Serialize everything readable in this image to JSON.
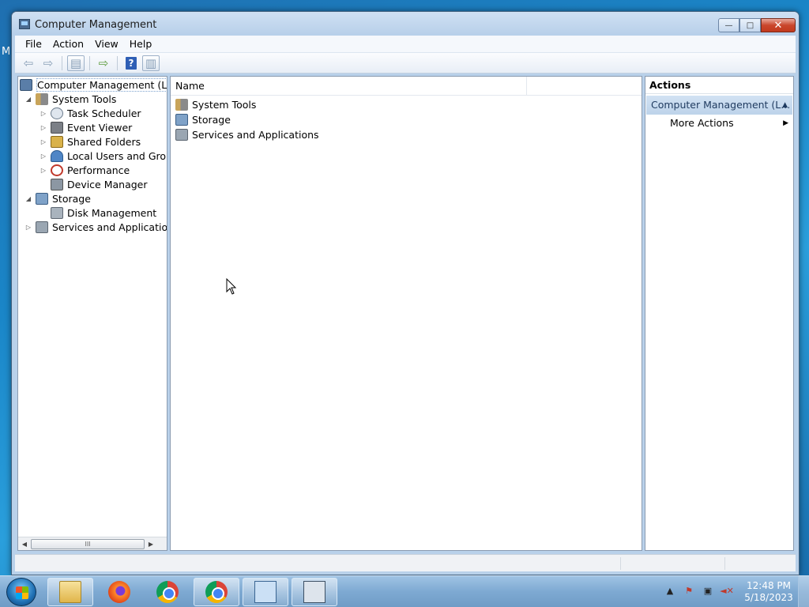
{
  "desktop": {
    "edge_letter": "M"
  },
  "window": {
    "title": "Computer Management",
    "controls": {
      "minimize": "—",
      "maximize": "□",
      "close": "✕"
    }
  },
  "menu": [
    "File",
    "Action",
    "View",
    "Help"
  ],
  "toolbar": {
    "help": "?"
  },
  "tree": {
    "root": "Computer Management (Local",
    "system_tools": "System Tools",
    "task_scheduler": "Task Scheduler",
    "event_viewer": "Event Viewer",
    "shared_folders": "Shared Folders",
    "local_users": "Local Users and Groups",
    "performance": "Performance",
    "device_manager": "Device Manager",
    "storage": "Storage",
    "disk_management": "Disk Management",
    "services_apps": "Services and Applications",
    "scroll_grip": "III"
  },
  "list": {
    "column_name": "Name",
    "items": [
      "System Tools",
      "Storage",
      "Services and Applications"
    ]
  },
  "actions": {
    "title": "Actions",
    "group": "Computer Management (L...",
    "more": "More Actions"
  },
  "taskbar": {
    "clock_time": "12:48 PM",
    "clock_date": "5/18/2023"
  }
}
